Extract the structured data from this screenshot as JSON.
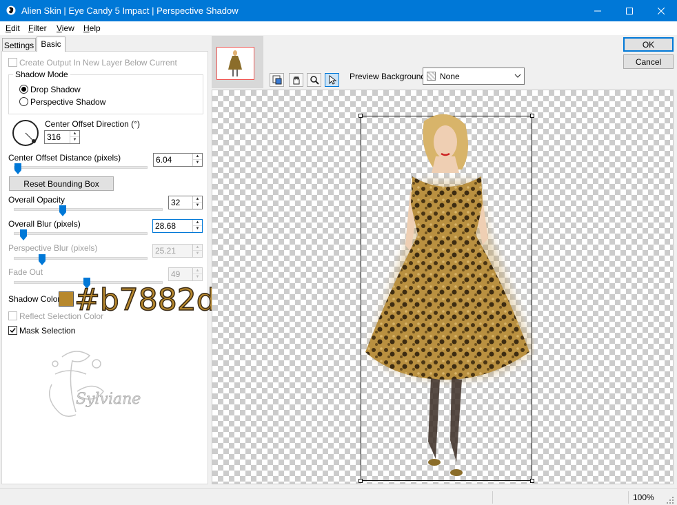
{
  "window": {
    "title": "Alien Skin | Eye Candy 5 Impact | Perspective Shadow",
    "minimize_glyph": "—",
    "maximize_glyph": "☐",
    "close_glyph": "✕"
  },
  "menu": [
    {
      "label": "Edit",
      "key": "E",
      "rest": "dit"
    },
    {
      "label": "Filter",
      "key": "F",
      "rest": "ilter"
    },
    {
      "label": "View",
      "key": "V",
      "rest": "iew"
    },
    {
      "label": "Help",
      "key": "H",
      "rest": "elp"
    }
  ],
  "tabs": {
    "settings": "Settings",
    "basic": "Basic",
    "active": "Basic"
  },
  "basic": {
    "create_output_label": "Create Output In New Layer Below Current",
    "create_output_checked": false,
    "shadow_mode": {
      "title": "Shadow Mode",
      "options": [
        "Drop Shadow",
        "Perspective Shadow"
      ],
      "selected": "Drop Shadow"
    },
    "center_offset_direction": {
      "label": "Center Offset Direction (°)",
      "value": "316"
    },
    "center_offset_distance": {
      "label": "Center Offset Distance (pixels)",
      "value": "6.04",
      "slider_fraction": 0.05
    },
    "reset_button": "Reset Bounding Box",
    "overall_opacity": {
      "label": "Overall Opacity",
      "value": "32",
      "slider_fraction": 0.32
    },
    "overall_blur": {
      "label": "Overall Blur (pixels)",
      "value": "28.68",
      "slider_fraction": 0.07
    },
    "perspective_blur": {
      "label": "Perspective Blur (pixels)",
      "value": "25.21",
      "slider_fraction": 0.2,
      "disabled": true
    },
    "fade_out": {
      "label": "Fade Out",
      "value": "49",
      "slider_fraction": 0.49,
      "disabled": true
    },
    "shadow_color": {
      "label": "Shadow Color",
      "hex": "#b7882d",
      "annotation": "#b7882d"
    },
    "reflect_selection": {
      "label": "Reflect Selection Color",
      "checked": false,
      "disabled": true
    },
    "mask_selection": {
      "label": "Mask Selection",
      "checked": true
    }
  },
  "watermark": "Sylviane",
  "buttons": {
    "ok": "OK",
    "cancel": "Cancel"
  },
  "preview_background": {
    "label": "Preview Background:",
    "value": "None"
  },
  "tools": [
    "bounding-box-tool-icon",
    "hand-tool-icon",
    "zoom-tool-icon",
    "pointer-tool-icon"
  ],
  "status": {
    "zoom": "100%"
  },
  "colors": {
    "accent": "#0078d7",
    "shadow": "#b7882d"
  }
}
